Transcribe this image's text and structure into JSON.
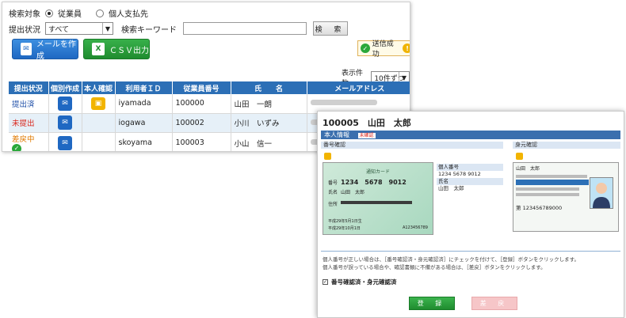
{
  "search": {
    "target_label": "検索対象",
    "target_options": [
      "従業員",
      "個人支払先"
    ],
    "status_label": "提出状況",
    "status_value": "すべて",
    "keyword_label": "検索キーワード",
    "keyword_value": "",
    "search_button": "検 索"
  },
  "actions": {
    "mail_button": "メールを作成",
    "csv_button": "ＣＳＶ出力"
  },
  "toast": {
    "text": "送信成功"
  },
  "paging": {
    "label": "表示件数",
    "value": "10件ずつ"
  },
  "table": {
    "headers": [
      "提出状況",
      "個別作成",
      "本人確認",
      "利用者ＩＤ",
      "従業員番号",
      "氏　　名",
      "メールアドレス"
    ],
    "rows": [
      {
        "status": "提出済",
        "status_color": "#1f4fa8",
        "id_check": true,
        "user_id": "iyamada",
        "emp_no": "100000",
        "name": "山田　一朗"
      },
      {
        "status": "未提出",
        "status_color": "#d9261c",
        "id_check": false,
        "user_id": "iogawa",
        "emp_no": "100002",
        "name": "小川　いずみ"
      },
      {
        "status": "差戻中",
        "status_color": "#e07a00",
        "id_check": false,
        "user_id": "skoyama",
        "emp_no": "100003",
        "name": "小山　信一"
      }
    ]
  },
  "detail": {
    "title": "100005　山田　太郎",
    "section": "本人情報",
    "badge": "未確認",
    "number_check_label": "番号確認",
    "identity_check_label": "身元確認",
    "card_header": "通知カード",
    "card_no": "1234　5678　9012",
    "card_name": "山田　太郎",
    "card_number_label": "番号",
    "card_name_label": "氏名",
    "card_address_label": "住所",
    "card_date": "平成29年5月1日生",
    "card_issue": "平成29年10月1日",
    "card_code": "A123456789",
    "info_rows": [
      {
        "label": "個人番号",
        "value": "1234 5678 9012"
      },
      {
        "label": "氏名",
        "value": "山田　太郎"
      }
    ],
    "license_name": "山田　太郎",
    "license_number": "第 123456789000",
    "notes": [
      "個人番号が正しい場合は、［番号確認済・身元確認済］にチェックを付けて、［登録］ボタンをクリックします。",
      "個人番号が誤っている場合や、確認書類に不備がある場合は、［差戻］ボタンをクリックします。"
    ],
    "confirm_checkbox": "番号確認済・身元確認済",
    "register_button": "登 録",
    "reject_button": "差 戻"
  }
}
